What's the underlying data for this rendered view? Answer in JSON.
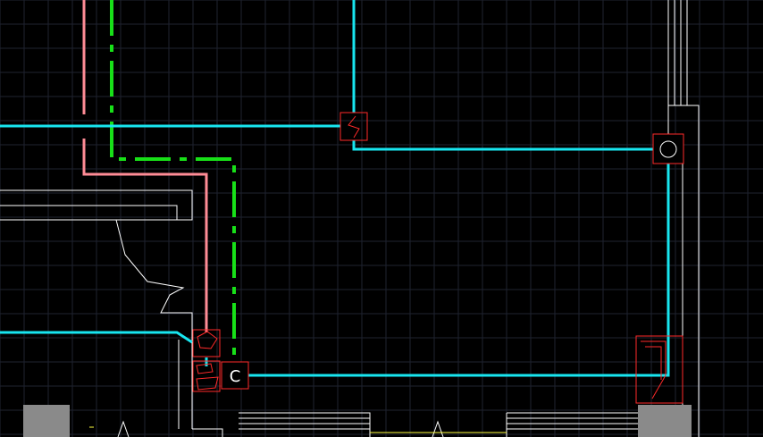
{
  "app": {
    "kind": "CAD drawing viewport"
  },
  "colors": {
    "background": "#000000",
    "grid": "#1f2330",
    "cyan_line": "#18e6f0",
    "green_line": "#18e018",
    "pink_line": "#ff8c96",
    "wall": "#ffffff",
    "symbol": "#ff2a2a",
    "gray_block": "#8a8a8a",
    "yellow": "#ffff40"
  },
  "symbols": {
    "switch_label": "",
    "outlet_circle": "",
    "c_box_label": "C"
  },
  "icons": [
    "switch-symbol-icon",
    "outlet-symbol-icon",
    "junction-c-icon",
    "fixture-symbol-icon",
    "panel-symbol-icon"
  ]
}
